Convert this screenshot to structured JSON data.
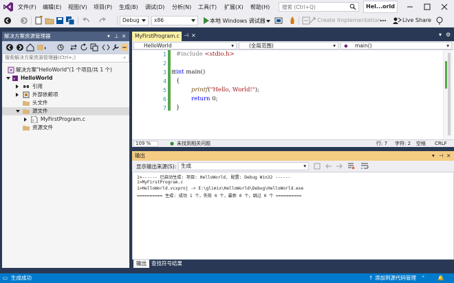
{
  "menubar": {
    "items": [
      "文件(F)",
      "编辑(E)",
      "视图(V)",
      "项目(P)",
      "生成(B)",
      "调试(D)",
      "分析(N)",
      "工具(T)",
      "扩展(X)",
      "帮助(H)"
    ],
    "search_placeholder": "搜索 (Ctrl+Q)",
    "app_title": "Hel...orld"
  },
  "toolbar": {
    "config": "Debug",
    "platform": "x86",
    "run_label": "本地 Windows 调试器",
    "create_impl": "Create Implementation",
    "live_share": "Live Share"
  },
  "solution_explorer": {
    "title": "解决方案资源管理器",
    "search_placeholder": "搜索解决方案资源管理器(Ctrl+;)",
    "tree": [
      {
        "label": "解决方案\"HelloWorld\"(1 个项目/共 1 个)",
        "icon": "solution-icon"
      },
      {
        "label": "HelloWorld",
        "icon": "project-icon",
        "bold": true
      },
      {
        "label": "引用",
        "icon": "references-icon"
      },
      {
        "label": "外部依赖项",
        "icon": "external-deps-icon"
      },
      {
        "label": "头文件",
        "icon": "folder-icon"
      },
      {
        "label": "源文件",
        "icon": "folder-icon"
      },
      {
        "label": "MyFirstProgram.c",
        "icon": "c-file-icon"
      },
      {
        "label": "资源文件",
        "icon": "folder-icon"
      }
    ]
  },
  "editor": {
    "tab_label": "MyFirstProgram.c",
    "nav_project": "HelloWorld",
    "nav_scope": "(全局范围)",
    "nav_member": "main()",
    "line_numbers": [
      "1",
      "2",
      "3",
      "4",
      "5",
      "6",
      "7"
    ],
    "code": {
      "l1_pp": "#include",
      "l1_hdr": " <stdio.h>",
      "l3_kw": "int",
      "l3_rest": " main()",
      "l4": "{",
      "l5_fn": "printf",
      "l5_open": "(",
      "l5_str": "\"Hello, World!\"",
      "l5_close": ");",
      "l6_kw": "return",
      "l6_rest": " 0;",
      "l7": "}"
    },
    "status": {
      "zoom": "109 %",
      "issues": "未找到相关问题",
      "line": "行: 7",
      "col": "字符: 2",
      "spacing": "空格",
      "eol": "CRLF"
    }
  },
  "output": {
    "title": "输出",
    "source_label": "显示输出来源(S):",
    "source_value": "生成",
    "lines": [
      "1>------ 已启动生成: 项目: HelloWorld, 配置: Debug Win32 ------",
      "1>MyFirstProgram.c",
      "1>HelloWorld.vcxproj -> E:\\glimix\\HelloWorld\\Debug\\HelloWorld.exe",
      "========== 生成: 成功 1 个，失败 0 个，最新 0 个，跳过 0 个 =========="
    ],
    "tabs": [
      "输出",
      "查找符号结果"
    ]
  },
  "statusbar": {
    "left": "生成成功",
    "right": "添加到源代码管理"
  },
  "colors": {
    "accent": "#007acc",
    "tab_active": "#fff1a8",
    "output_title": "#f5cc84",
    "panel_title": "#4d6082"
  }
}
